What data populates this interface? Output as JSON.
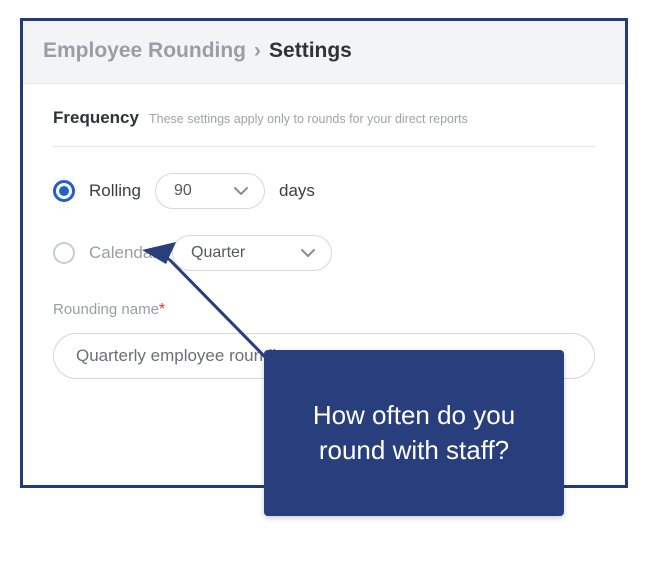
{
  "breadcrumb": {
    "parent": "Employee Rounding",
    "separator": "›",
    "current": "Settings"
  },
  "frequency": {
    "title": "Frequency",
    "subtext": "These settings apply only to rounds for your direct reports",
    "options": {
      "rolling": {
        "label": "Rolling",
        "value": "90",
        "suffix": "days",
        "selected": true
      },
      "calendar": {
        "label": "Calendar",
        "value": "Quarter",
        "selected": false
      }
    }
  },
  "rounding_name": {
    "label": "Rounding name",
    "required_marker": "*",
    "value": "Quarterly employee rounding"
  },
  "callout": {
    "text": "How often do you round with staff?"
  },
  "colors": {
    "accent": "#1f5fcf",
    "window_border": "#253a7a",
    "callout_bg": "#283e7d"
  }
}
